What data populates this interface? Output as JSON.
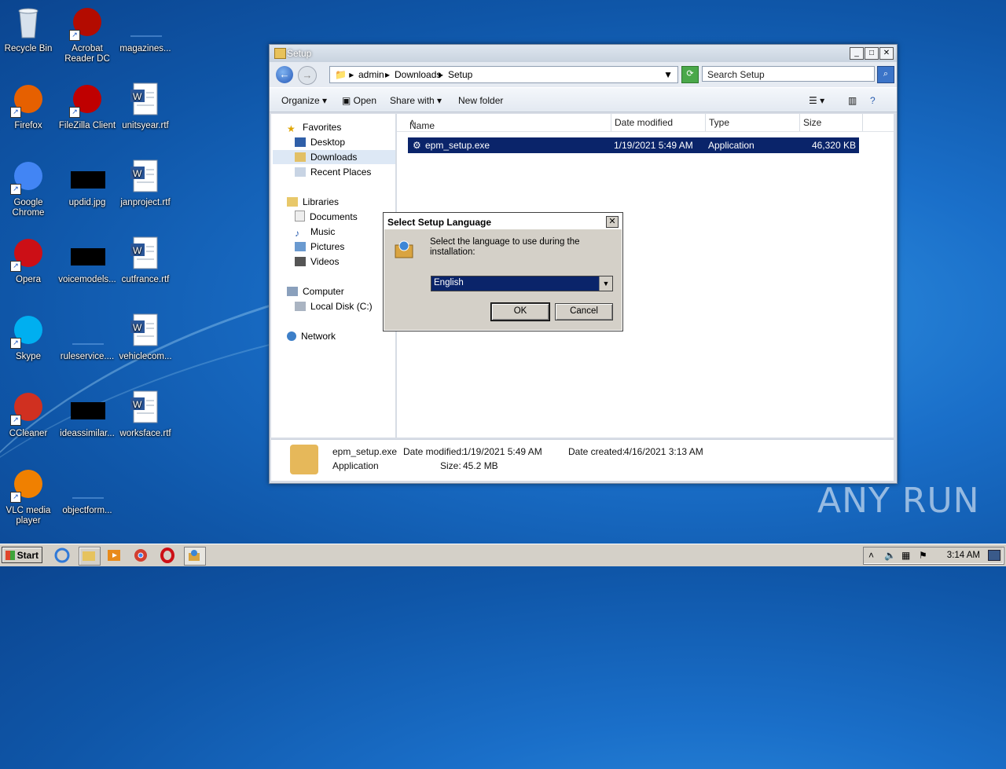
{
  "desktop": {
    "icons": [
      {
        "label": "Recycle Bin",
        "icon": "recycle-bin-icon"
      },
      {
        "label": "Acrobat Reader DC",
        "icon": "acrobat-icon"
      },
      {
        "label": "magazines...",
        "icon": "file-icon"
      },
      {
        "label": "Firefox",
        "icon": "firefox-icon"
      },
      {
        "label": "FileZilla Client",
        "icon": "filezilla-icon"
      },
      {
        "label": "unitsyear.rtf",
        "icon": "word-doc-icon"
      },
      {
        "label": "Google Chrome",
        "icon": "chrome-icon"
      },
      {
        "label": "updid.jpg",
        "icon": "image-file-icon"
      },
      {
        "label": "janproject.rtf",
        "icon": "word-doc-icon"
      },
      {
        "label": "Opera",
        "icon": "opera-icon"
      },
      {
        "label": "voicemodels...",
        "icon": "image-file-icon"
      },
      {
        "label": "cutfrance.rtf",
        "icon": "word-doc-icon"
      },
      {
        "label": "Skype",
        "icon": "skype-icon"
      },
      {
        "label": "ruleservice....",
        "icon": "file-icon"
      },
      {
        "label": "vehiclecom...",
        "icon": "word-doc-icon"
      },
      {
        "label": "CCleaner",
        "icon": "ccleaner-icon"
      },
      {
        "label": "ideassimilar...",
        "icon": "image-file-icon"
      },
      {
        "label": "worksface.rtf",
        "icon": "word-doc-icon"
      },
      {
        "label": "VLC media player",
        "icon": "vlc-icon"
      },
      {
        "label": "objectform...",
        "icon": "file-icon"
      }
    ]
  },
  "explorer": {
    "title": "Setup",
    "breadcrumb": [
      "admin",
      "Downloads",
      "Setup"
    ],
    "search_placeholder": "Search Setup",
    "toolbar": {
      "organize": "Organize",
      "open": "Open",
      "share_with": "Share with",
      "new_folder": "New folder"
    },
    "nav": {
      "favorites": "Favorites",
      "desktop": "Desktop",
      "downloads": "Downloads",
      "recent": "Recent Places",
      "libraries": "Libraries",
      "documents": "Documents",
      "music": "Music",
      "pictures": "Pictures",
      "videos": "Videos",
      "computer": "Computer",
      "local_disk": "Local Disk (C:)",
      "network": "Network"
    },
    "columns": {
      "name": "Name",
      "date": "Date modified",
      "type": "Type",
      "size": "Size"
    },
    "file": {
      "name": "epm_setup.exe",
      "date": "1/19/2021 5:49 AM",
      "type": "Application",
      "size": "46,320 KB"
    },
    "details": {
      "name": "epm_setup.exe",
      "type": "Application",
      "date_modified_label": "Date modified:",
      "date_modified": "1/19/2021 5:49 AM",
      "date_created_label": "Date created:",
      "date_created": "4/16/2021 3:13 AM",
      "size_label": "Size:",
      "size": "45.2 MB"
    }
  },
  "dialog": {
    "title": "Select Setup Language",
    "message": "Select the language to use during the installation:",
    "selected_language": "English",
    "ok": "OK",
    "cancel": "Cancel"
  },
  "taskbar": {
    "start": "Start",
    "clock": "3:14 AM"
  },
  "watermark": "ANY RUN"
}
